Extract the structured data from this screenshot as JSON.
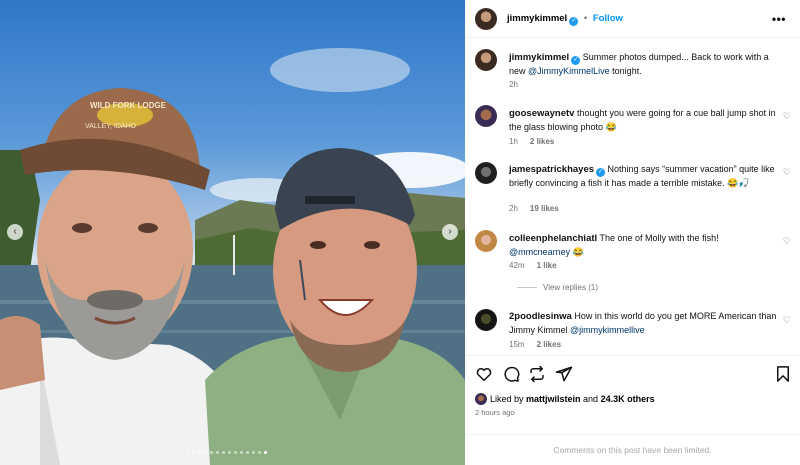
{
  "post": {
    "author": "jimmykimmel",
    "follow_label": "Follow",
    "more_label": "•••",
    "caption_prefix": "Summer photos dumped... Back to work with a new ",
    "caption_mention": "@JimmyKimmelLive",
    "caption_suffix": " tonight.",
    "caption_time": "2h"
  },
  "comments": [
    {
      "user": "goosewaynetv",
      "verified": false,
      "text": "thought you were going for a cue ball jump shot in the glass blowing photo 😂",
      "time": "1h",
      "likes": "2 likes"
    },
    {
      "user": "jamespatrickhayes",
      "verified": true,
      "text": "Nothing says “summer vacation” quite like briefly convincing a fish it has made a terrible mistake. 😂🎣",
      "time": "2h",
      "likes": "19 likes"
    },
    {
      "user": "colleenphelanchiatl",
      "verified": false,
      "text_prefix": "The one of Molly with the fish! ",
      "mention": "@mmcnearney",
      "text_suffix": " 😂",
      "time": "42m",
      "likes": "1 like",
      "view_replies": "View replies (1)"
    },
    {
      "user": "2poodlesinwa",
      "verified": false,
      "text_prefix": "How in this world do you get MORE American than Jimmy Kimmel ",
      "mention": "@jimmykimmellive",
      "time": "15m",
      "likes": "2 likes"
    }
  ],
  "actions": {
    "liked_prefix": "Liked by ",
    "liked_user": "mattjwilstein",
    "liked_and": " and ",
    "liked_count": "24.3K others",
    "posted_time": "2 hours ago"
  },
  "footer": {
    "limited": "Comments on this post have been limited."
  },
  "icons": {
    "verified": "verified-badge-icon",
    "heart": "heart-icon",
    "comment": "comment-icon",
    "repost": "repost-icon",
    "share": "share-icon",
    "bookmark": "bookmark-icon",
    "nav_prev": "chevron-left-icon",
    "nav_next": "chevron-right-icon"
  },
  "colors": {
    "accent": "#0095f6",
    "verified": "#1d9bf0",
    "mention": "#00376b",
    "muted": "#737373"
  },
  "carousel": {
    "slides": 14,
    "current": 13
  },
  "photo_text": {
    "cap_text": "WILD FORK LODGE",
    "cap_subtext": "VALLEY, IDAHO"
  }
}
